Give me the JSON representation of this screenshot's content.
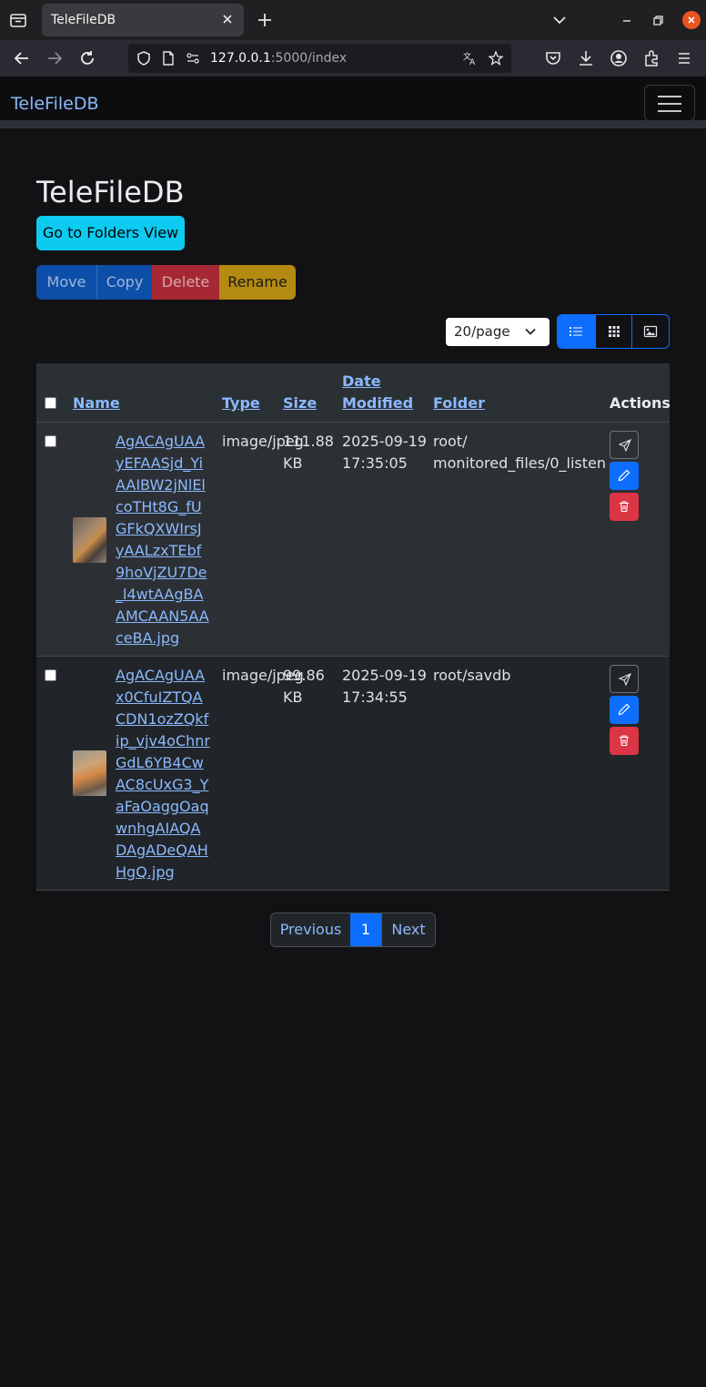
{
  "browser": {
    "tab_title": "TeleFileDB",
    "url_host": "127.0.0.1",
    "url_rest": ":5000/index"
  },
  "app": {
    "brand": "TeleFileDB",
    "page_title": "TeleFileDB",
    "folders_button": "Go to Folders View"
  },
  "actions": {
    "move": "Move",
    "copy": "Copy",
    "delete": "Delete",
    "rename": "Rename"
  },
  "controls": {
    "per_page": "20/page"
  },
  "table": {
    "headers": {
      "name": "Name",
      "type": "Type",
      "size": "Size",
      "date_line1": "Date",
      "date_line2": "Modified",
      "folder": "Folder",
      "actions": "Actions"
    },
    "rows": [
      {
        "name": "AgACAgUAAyEFAASjd_YiAAIBW2jNlElcoTHt8G_fUGFkQXWIrsJyAALzxTEbf9hoVjZU7De_l4wtAAgBAAMCAAN5AAceBA.jpg",
        "type": "image/jpeg",
        "size": "111.88 KB",
        "date": "2025-09-19",
        "time": "17:35:05",
        "folder_line1": "root/",
        "folder_line2": "monitored_files/0_listen"
      },
      {
        "name": "AgACAgUAAx0CfuIZTQACDN1ozZQkfip_vjv4oChnrGdL6YB4CwAC8cUxG3_YaFaOaggOaqwnhgAIAQADAgADeQAHHgQ.jpg",
        "type": "image/jpeg",
        "size": "99.86 KB",
        "date": "2025-09-19",
        "time": "17:34:55",
        "folder_line1": "root/savdb",
        "folder_line2": ""
      }
    ]
  },
  "pagination": {
    "previous": "Previous",
    "current": "1",
    "next": "Next"
  },
  "colors": {
    "accent": "#0d6efd",
    "info": "#0dcaf0",
    "danger": "#dc3545",
    "warning": "#b58a10",
    "link": "#8bb9fe"
  },
  "icons": [
    "tab-list-icon",
    "close-icon",
    "plus-icon",
    "chevron-down-icon",
    "minimize-icon",
    "maximize-icon",
    "back-icon",
    "forward-icon",
    "reload-icon",
    "shield-icon",
    "page-icon",
    "permissions-icon",
    "translate-icon",
    "star-icon",
    "pocket-icon",
    "download-icon",
    "account-icon",
    "extensions-icon",
    "menu-icon",
    "hamburger-icon",
    "list-view-icon",
    "grid-view-icon",
    "gallery-view-icon",
    "send-icon",
    "pencil-icon",
    "trash-icon"
  ]
}
